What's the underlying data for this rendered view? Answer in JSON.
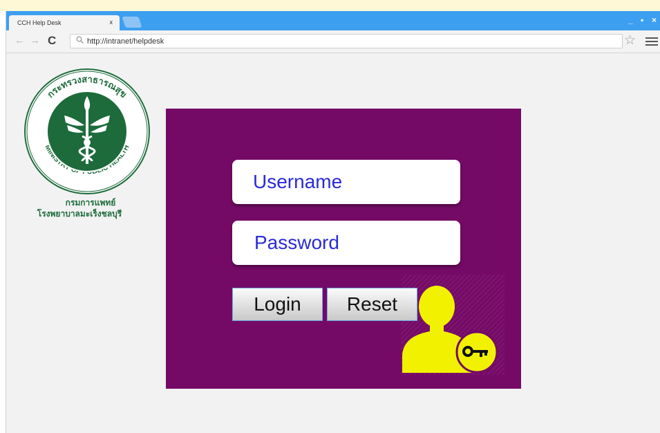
{
  "browser": {
    "tab_title": "CCH Help Desk",
    "tab_close": "x",
    "back": "←",
    "forward": "→",
    "reload": "C",
    "url": "http://intranet/helpdesk",
    "star": "☆",
    "window_controls": [
      "_",
      "▪",
      "×"
    ]
  },
  "org": {
    "seal_top_text": "กระทรวงสาธารณสุข",
    "seal_bottom_text": "MINISTRY OF PUBLIC HEALTH",
    "line1": "กรมการแพทย์",
    "line2": "โรงพยาบาลมะเร็งชลบุรี"
  },
  "login": {
    "username_placeholder": "Username",
    "password_placeholder": "Password",
    "login_label": "Login",
    "reset_label": "Reset"
  },
  "colors": {
    "panel": "#750a66",
    "tabbar": "#3d9ff0",
    "seal_green": "#1d6b3b",
    "icon_yellow": "#f2f200",
    "field_text": "#2a2ad8"
  },
  "icons": [
    "search-icon",
    "star-icon",
    "menu-icon",
    "user-key-icon",
    "ministry-seal"
  ]
}
